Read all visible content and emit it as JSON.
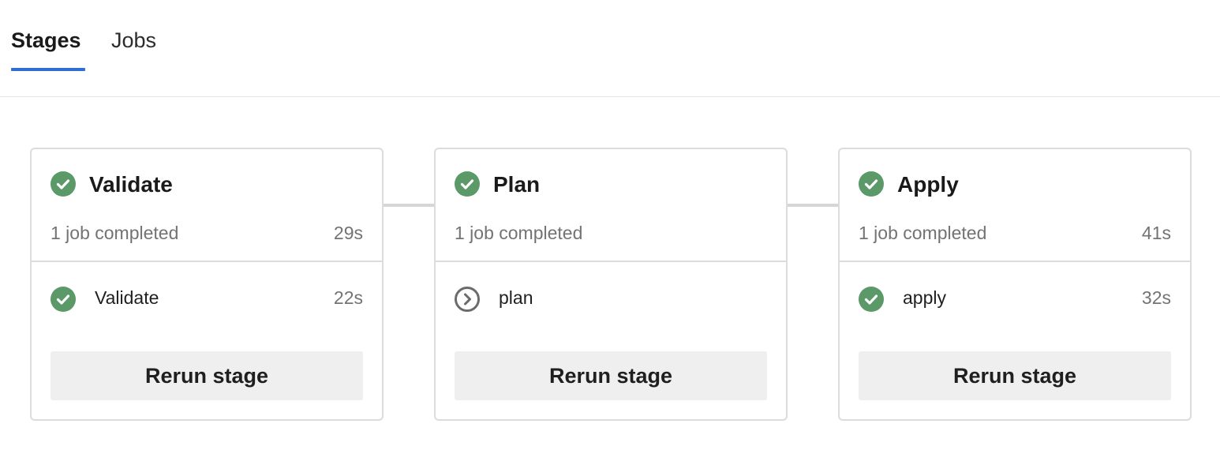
{
  "tabs": [
    {
      "label": "Stages",
      "active": true
    },
    {
      "label": "Jobs",
      "active": false
    }
  ],
  "colors": {
    "success": "#5b9a68",
    "skipped": "#6b6b6b",
    "tab_accent": "#2f6fd1"
  },
  "stages": [
    {
      "title": "Validate",
      "status_icon": "success-check-icon",
      "summary": "1 job completed",
      "duration": "29s",
      "job": {
        "name": "Validate",
        "status_icon": "success-check-icon",
        "duration": "22s"
      },
      "rerun_label": "Rerun stage"
    },
    {
      "title": "Plan",
      "status_icon": "success-check-icon",
      "summary": "1 job completed",
      "duration": "",
      "job": {
        "name": "plan",
        "status_icon": "skipped-chevron-icon",
        "duration": ""
      },
      "rerun_label": "Rerun stage"
    },
    {
      "title": "Apply",
      "status_icon": "success-check-icon",
      "summary": "1 job completed",
      "duration": "41s",
      "job": {
        "name": "apply",
        "status_icon": "success-check-icon",
        "duration": "32s"
      },
      "rerun_label": "Rerun stage"
    }
  ]
}
